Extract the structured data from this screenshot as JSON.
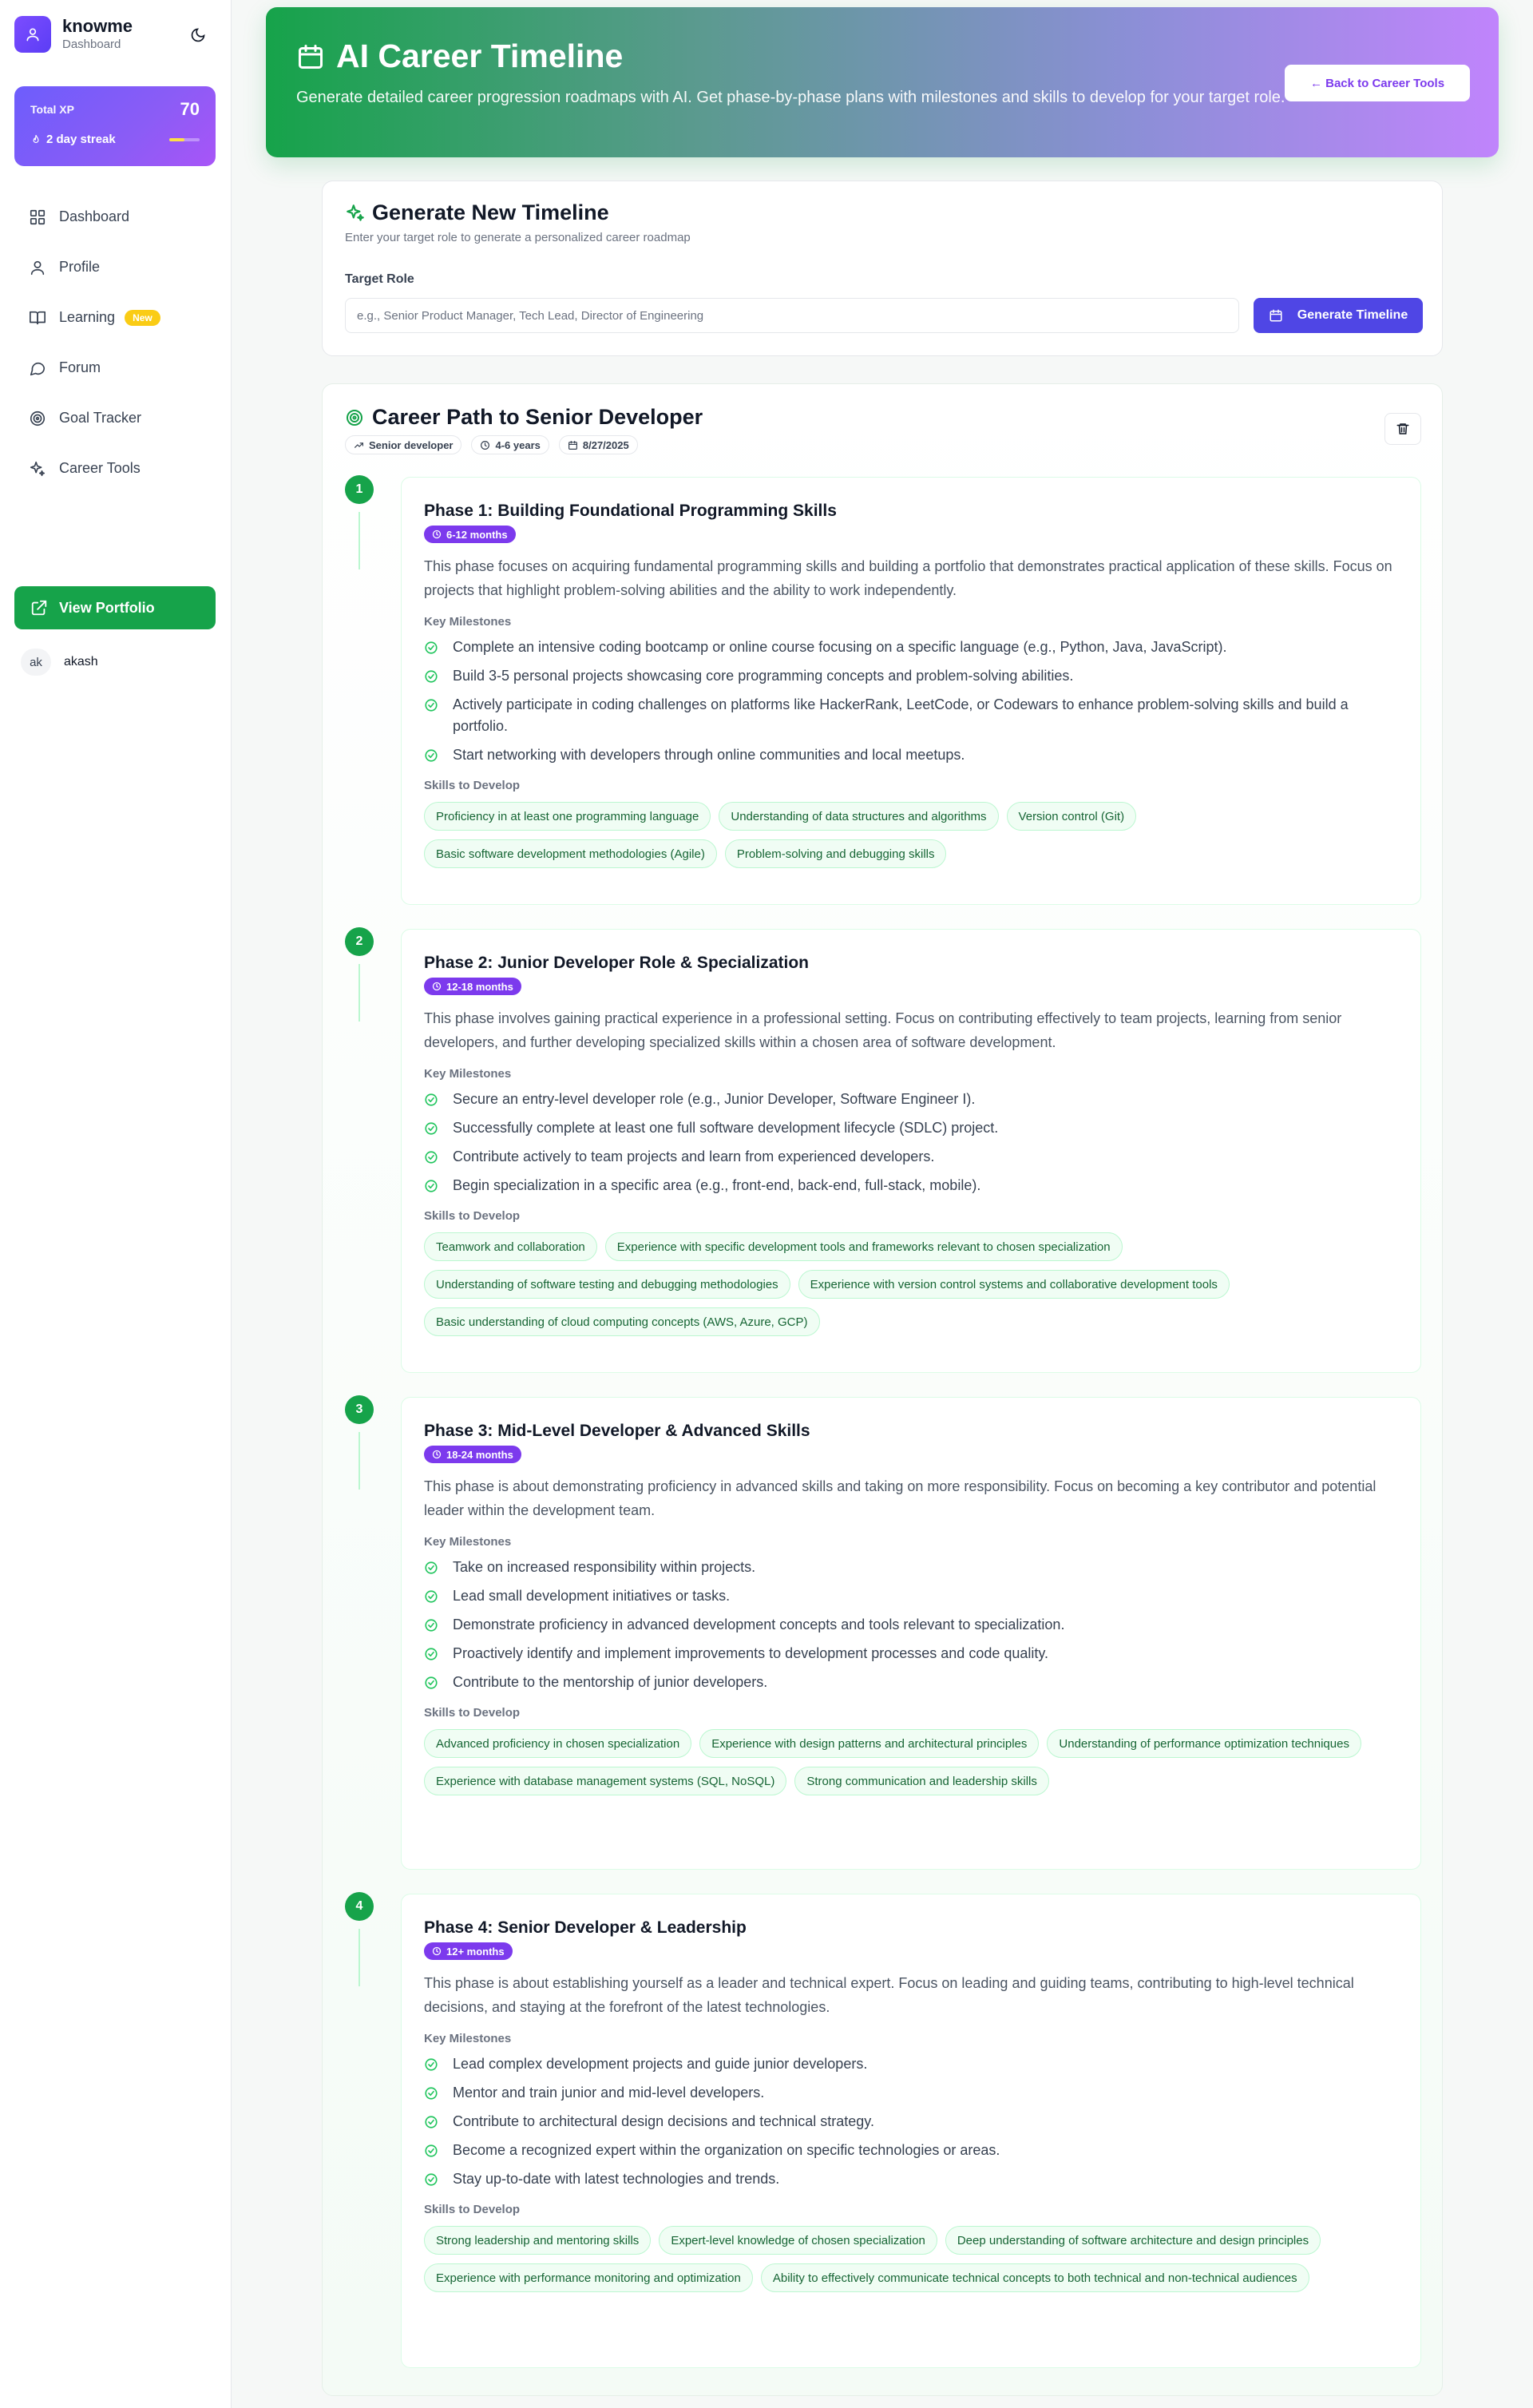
{
  "sidebar": {
    "brand_name": "knowme",
    "brand_sub": "Dashboard",
    "xp_label": "Total XP",
    "xp_value": "70",
    "streak_label": "2 day streak",
    "streak_progress": 0.5,
    "nav": [
      {
        "label": "Dashboard",
        "icon": "grid-icon"
      },
      {
        "label": "Profile",
        "icon": "user-icon"
      },
      {
        "label": "Learning",
        "icon": "book-icon",
        "badge": "New"
      },
      {
        "label": "Forum",
        "icon": "chat-icon"
      },
      {
        "label": "Goal Tracker",
        "icon": "target-icon"
      },
      {
        "label": "Career Tools",
        "icon": "sparkles-icon"
      }
    ],
    "portfolio_label": "View Portfolio",
    "user_initials": "ak",
    "user_name": "akash"
  },
  "hero": {
    "title": "AI Career Timeline",
    "description": "Generate detailed career progression roadmaps with AI. Get phase-by-phase plans with milestones and skills to develop for your target role.",
    "back_label": "← Back to Career Tools"
  },
  "generate": {
    "title": "Generate New Timeline",
    "subtitle": "Enter your target role to generate a personalized career roadmap",
    "input_label": "Target Role",
    "input_value": "",
    "input_placeholder": "e.g., Senior Product Manager, Tech Lead, Director of Engineering",
    "button_label": "Generate Timeline"
  },
  "path": {
    "title": "Career Path to Senior Developer",
    "role_chip": "Senior developer",
    "years_chip": "4-6 years",
    "date_chip": "8/27/2025",
    "milestones_label": "Key Milestones",
    "skills_label": "Skills to Develop",
    "phases": [
      {
        "number": "1",
        "title": "Phase 1: Building Foundational Programming Skills",
        "duration": "6-12 months",
        "description": "This phase focuses on acquiring fundamental programming skills and building a portfolio that demonstrates practical application of these skills. Focus on projects that highlight problem-solving abilities and the ability to work independently.",
        "milestones": [
          "Complete an intensive coding bootcamp or online course focusing on a specific language (e.g., Python, Java, JavaScript).",
          "Build 3-5 personal projects showcasing core programming concepts and problem-solving abilities.",
          "Actively participate in coding challenges on platforms like HackerRank, LeetCode, or Codewars to enhance problem-solving skills and build a portfolio.",
          "Start networking with developers through online communities and local meetups."
        ],
        "skills": [
          "Proficiency in at least one programming language",
          "Understanding of data structures and algorithms",
          "Version control (Git)",
          "Basic software development methodologies (Agile)",
          "Problem-solving and debugging skills"
        ]
      },
      {
        "number": "2",
        "title": "Phase 2: Junior Developer Role & Specialization",
        "duration": "12-18 months",
        "description": "This phase involves gaining practical experience in a professional setting. Focus on contributing effectively to team projects, learning from senior developers, and further developing specialized skills within a chosen area of software development.",
        "milestones": [
          "Secure an entry-level developer role (e.g., Junior Developer, Software Engineer I).",
          "Successfully complete at least one full software development lifecycle (SDLC) project.",
          "Contribute actively to team projects and learn from experienced developers.",
          "Begin specialization in a specific area (e.g., front-end, back-end, full-stack, mobile)."
        ],
        "skills": [
          "Teamwork and collaboration",
          "Experience with specific development tools and frameworks relevant to chosen specialization",
          "Understanding of software testing and debugging methodologies",
          "Experience with version control systems and collaborative development tools",
          "Basic understanding of cloud computing concepts (AWS, Azure, GCP)"
        ]
      },
      {
        "number": "3",
        "title": "Phase 3: Mid-Level Developer & Advanced Skills",
        "duration": "18-24 months",
        "description": "This phase is about demonstrating proficiency in advanced skills and taking on more responsibility. Focus on becoming a key contributor and potential leader within the development team.",
        "milestones": [
          "Take on increased responsibility within projects.",
          "Lead small development initiatives or tasks.",
          "Demonstrate proficiency in advanced development concepts and tools relevant to specialization.",
          "Proactively identify and implement improvements to development processes and code quality.",
          "Contribute to the mentorship of junior developers."
        ],
        "skills": [
          "Advanced proficiency in chosen specialization",
          "Experience with design patterns and architectural principles",
          "Understanding of performance optimization techniques",
          "Experience with database management systems (SQL, NoSQL)",
          "Strong communication and leadership skills"
        ]
      },
      {
        "number": "4",
        "title": "Phase 4: Senior Developer & Leadership",
        "duration": "12+ months",
        "description": "This phase is about establishing yourself as a leader and technical expert. Focus on leading and guiding teams, contributing to high-level technical decisions, and staying at the forefront of the latest technologies.",
        "milestones": [
          "Lead complex development projects and guide junior developers.",
          "Mentor and train junior and mid-level developers.",
          "Contribute to architectural design decisions and technical strategy.",
          "Become a recognized expert within the organization on specific technologies or areas.",
          "Stay up-to-date with latest technologies and trends."
        ],
        "skills": [
          "Strong leadership and mentoring skills",
          "Expert-level knowledge of chosen specialization",
          "Deep understanding of software architecture and design principles",
          "Experience with performance monitoring and optimization",
          "Ability to effectively communicate technical concepts to both technical and non-technical audiences"
        ]
      }
    ]
  },
  "colors": {
    "brand_green": "#16a34a",
    "accent_purple": "#7c3aed",
    "indigo_button": "#4f46e5",
    "skill_bg": "#f0fdf4"
  }
}
